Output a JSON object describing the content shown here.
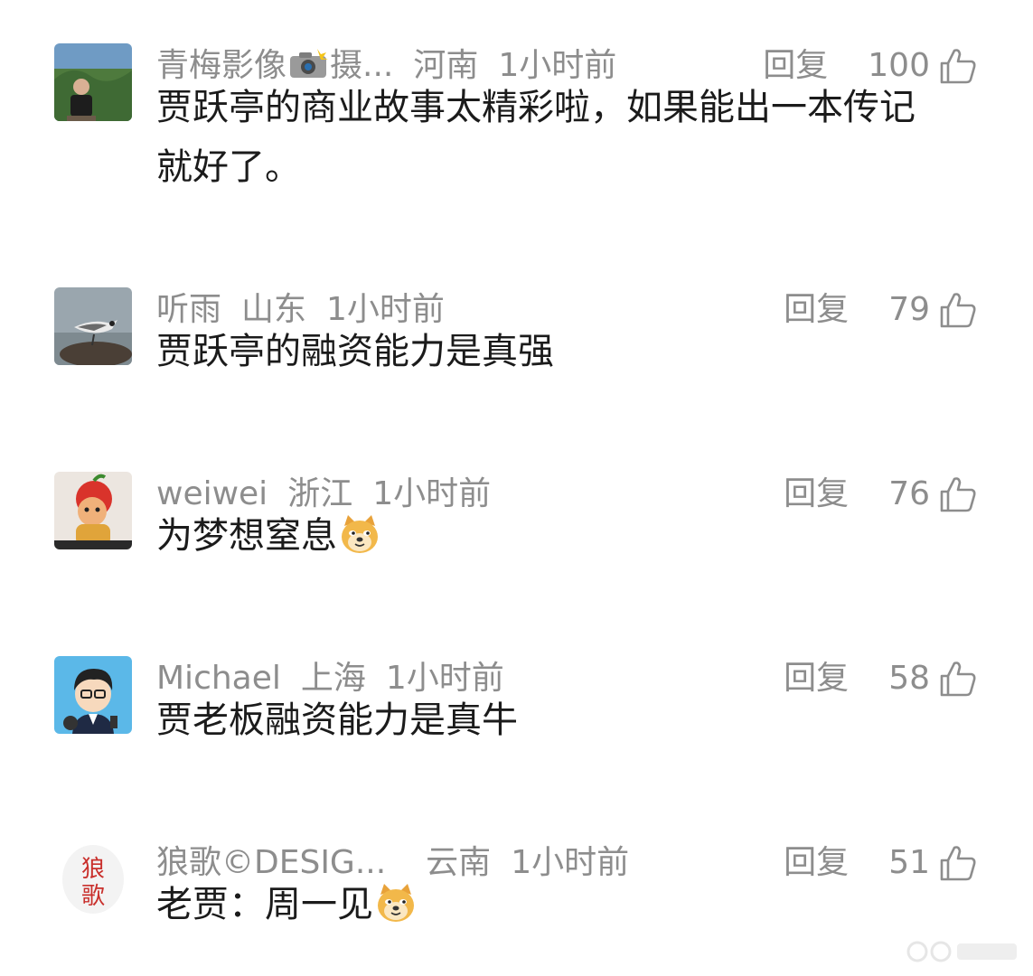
{
  "reply_label": "回复",
  "comments": [
    {
      "username": "青梅影像",
      "username_suffix": "摄...",
      "region": "河南",
      "time": "1小时前",
      "likes": "100",
      "text_line1": "贾跃亭的商业故事太精彩啦，如果能出一本传记",
      "text_line2": "就好了。"
    },
    {
      "username": "听雨",
      "region": "山东",
      "time": "1小时前",
      "likes": "79",
      "text": "贾跃亭的融资能力是真强"
    },
    {
      "username": "weiwei",
      "region": "浙江",
      "time": "1小时前",
      "likes": "76",
      "text": "为梦想窒息"
    },
    {
      "username": "Michael",
      "region": "上海",
      "time": "1小时前",
      "likes": "58",
      "text": "贾老板融资能力是真牛"
    },
    {
      "username": "狼歌©DESIG...",
      "region": "云南",
      "time": "1小时前",
      "likes": "51",
      "text": "老贾：周一见",
      "avatar_text_1": "狼",
      "avatar_text_2": "歌"
    }
  ],
  "colors": {
    "meta_gray": "#8d8d8d",
    "text_dark": "#1b1b1b",
    "avatar_red": "#c9302c"
  },
  "icons": {
    "like": "thumbs-up-icon",
    "emoji": "doge-emoji-icon",
    "camera": "camera-flash-icon"
  }
}
